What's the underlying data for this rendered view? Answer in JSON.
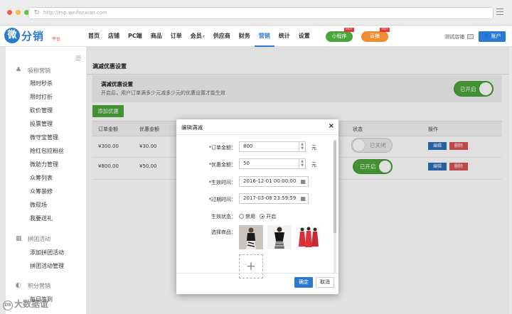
{
  "browser": {
    "url": "http://mp.weifenxiao.com"
  },
  "brand": {
    "logo_char": "微",
    "name": "分销",
    "sub": "平台"
  },
  "nav": {
    "items": [
      "首页",
      "店铺",
      "PC端",
      "商品",
      "订单",
      "会员",
      "供应商",
      "财务",
      "营销",
      "统计",
      "设置"
    ],
    "member_suffix": "▾",
    "active_index": 8,
    "miniprogram": "小程序",
    "live": "直播",
    "hot_badge": "HOT",
    "store_label": "测试店铺",
    "account_label": "账户"
  },
  "sidebar": {
    "sections": [
      {
        "title": "吸粉营销",
        "icon": "user-icon",
        "items": [
          "限时秒杀",
          "限时打折",
          "砍价管理",
          "投票管理",
          "微守宝管理",
          "抢红包拉粉丝",
          "微助力管理",
          "众筹列表",
          "众筹装修",
          "微现场",
          "我要送礼"
        ]
      },
      {
        "title": "拼团活动",
        "icon": "grid-icon",
        "items": [
          "添加拼团活动",
          "拼团活动管理"
        ]
      },
      {
        "title": "积分营销",
        "icon": "coin-icon",
        "items": [
          "每日签到"
        ]
      }
    ]
  },
  "main": {
    "title": "满减优惠设置",
    "setting": {
      "title": "满减优惠设置",
      "desc": "开启后，用户订单满多少元减多少元的优惠设置才能生效",
      "toggle_label": "已开启"
    },
    "add_button": "添加优惠",
    "table": {
      "headers": [
        "订单金额",
        "优惠金额",
        "状态",
        "操作"
      ],
      "rows": [
        {
          "order_amount": "¥300.00",
          "discount": "¥30.00",
          "status": "已关闭",
          "status_on": false
        },
        {
          "order_amount": "¥800.00",
          "discount": "¥50.00",
          "status": "已开启",
          "status_on": true
        }
      ],
      "edit_label": "编辑",
      "delete_label": "删除"
    }
  },
  "modal": {
    "title": "编辑满减",
    "close": "×",
    "fields": {
      "order_amount": {
        "label": "*订单金额：",
        "value": "800",
        "unit": "元"
      },
      "discount": {
        "label": "*优惠金额：",
        "value": "50",
        "unit": "元"
      },
      "start_time": {
        "label": "*生效时间：",
        "value": "2016-12-01 00:00:00"
      },
      "end_time": {
        "label": "*过期时间：",
        "value": "2017-03-08 23:59:59"
      },
      "status": {
        "label": "生效状态：",
        "options": [
          "禁用",
          "开启"
        ],
        "selected": "开启"
      },
      "goods": {
        "label": "选择商品：",
        "add": "+"
      }
    },
    "ok": "确定",
    "cancel": "取消"
  },
  "watermark": {
    "text": "大数据谊",
    "badge": "DB"
  },
  "colors": {
    "primary": "#2b7ad1",
    "green": "#4aa53a",
    "red": "#d9534f",
    "orange": "#f08c2e"
  }
}
